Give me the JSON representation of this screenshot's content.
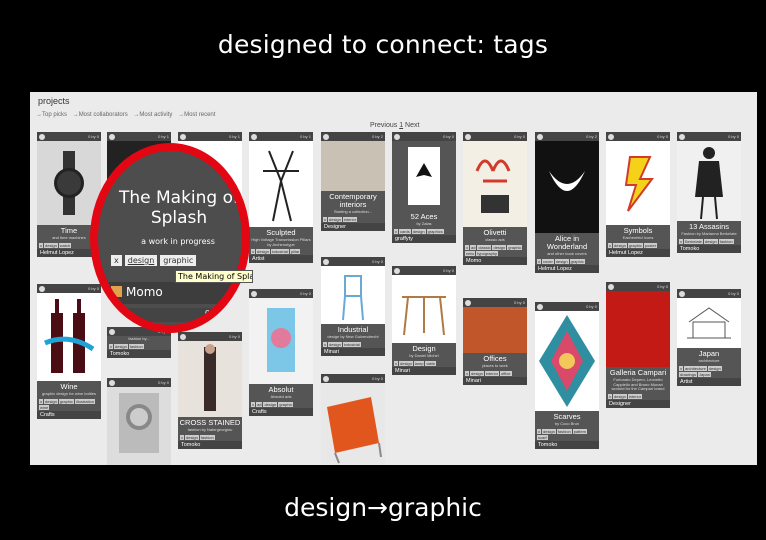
{
  "slide_title": "designed to connect: tags",
  "caption": "design→graphic",
  "app": {
    "heading": "projects",
    "nav": [
      "→Top picks",
      "→Most collaborators",
      "→Most activity",
      "→Most recent"
    ],
    "pager": {
      "prev": "Previous",
      "page": "1",
      "next": "Next"
    }
  },
  "cards": [
    {
      "title": "Time",
      "sub": "and time machines",
      "tags": [
        "x",
        "design",
        "watch"
      ],
      "user": "Helmut Lopez",
      "stat": "0 by 0"
    },
    {
      "title": "",
      "sub": "",
      "tags": [],
      "user": "",
      "stat": "0 by 1"
    },
    {
      "title": "",
      "sub": "",
      "tags": [],
      "user": "",
      "stat": "0 by 1"
    },
    {
      "title": "Sculpted",
      "sub": "High Voltage Transmission Pillars by Archenotype",
      "tags": [
        "x",
        "design",
        "industrial",
        "pillar"
      ],
      "user": "Artist",
      "stat": "0 by 1"
    },
    {
      "title": "Contemporary interiors",
      "sub": "Starting a collection...",
      "tags": [
        "x",
        "design",
        "interior"
      ],
      "user": "Designer",
      "stat": "0 by 2"
    },
    {
      "title": "52 Aces",
      "sub": "by Zalas",
      "tags": [
        "x",
        "cards",
        "design",
        "graphics"
      ],
      "user": "graffyty",
      "stat": "0 by 0"
    },
    {
      "title": "Olivetti",
      "sub": "classic ads",
      "tags": [
        "x",
        "ad",
        "classic",
        "design",
        "graphic",
        "retro",
        "typography"
      ],
      "user": "Momo",
      "stat": "0 by 0"
    },
    {
      "title": "Alice in Wonderland",
      "sub": "and other book covers",
      "tags": [
        "x",
        "cover",
        "design",
        "graphic"
      ],
      "user": "Helmut Lopez",
      "stat": "0 by 2"
    },
    {
      "title": "Symbols",
      "sub": "Eachenfeld Icons",
      "tags": [
        "x",
        "design",
        "graphic",
        "poster"
      ],
      "user": "Helmut Lopez",
      "stat": "0 by 0"
    },
    {
      "title": "13 Assasins",
      "sub": "Fashion by Marianna Berkelate",
      "tags": [
        "x",
        "Berkelate",
        "design",
        "fashion"
      ],
      "user": "Tomoko",
      "stat": "0 by 0"
    },
    {
      "title": "Wine",
      "sub": "graphic design for wine bottles",
      "tags": [
        "x",
        "design",
        "graphic",
        "illustration",
        "wine"
      ],
      "user": "Crafts",
      "stat": "0 by 0"
    },
    {
      "title": "",
      "sub": "fashion by...",
      "tags": [
        "x",
        "design",
        "fashion"
      ],
      "user": "Tomoko",
      "stat": "0 by 0"
    },
    {
      "title": "CROSS STAINED",
      "sub": "fashion by Natergeorgiou",
      "tags": [
        "x",
        "design",
        "fashion"
      ],
      "user": "Tomoko",
      "stat": "0 by 0"
    },
    {
      "title": "Absolut",
      "sub": "Absolut ads",
      "tags": [
        "x",
        "ad",
        "design",
        "graphic"
      ],
      "user": "Crafts",
      "stat": "0 by 0"
    },
    {
      "title": "Industrial",
      "sub": "design by New Gulvendrecht",
      "tags": [
        "x",
        "design",
        "industrial"
      ],
      "user": "Minari",
      "stat": "0 by 0"
    },
    {
      "title": "",
      "sub": "",
      "tags": [],
      "user": "",
      "stat": "0 by 0"
    },
    {
      "title": "Design",
      "sub": "by Daniel Michel",
      "tags": [
        "x",
        "design",
        "lamp",
        "table"
      ],
      "user": "Minari",
      "stat": "0 by 0"
    },
    {
      "title": "Offices",
      "sub": "places to work",
      "tags": [
        "x",
        "design",
        "interior",
        "office"
      ],
      "user": "Minari",
      "stat": "0 by 0"
    },
    {
      "title": "Scarves",
      "sub": "by Coco Brun",
      "tags": [
        "x",
        "design",
        "fashion",
        "pattern",
        "scarf"
      ],
      "user": "Tomoko",
      "stat": "0 by 0"
    },
    {
      "title": "Galleria Campari",
      "sub": "Fortunato Depero, Leonetto Cappiello and Bruno Munari worked for the Campari brand",
      "tags": [
        "x",
        "design",
        "interior"
      ],
      "user": "Designer",
      "stat": "0 by 0"
    },
    {
      "title": "Japan",
      "sub": "architecture",
      "tags": [
        "x",
        "architecture",
        "design",
        "drawings",
        "Japan"
      ],
      "user": "Artist",
      "stat": "0 by 0"
    }
  ],
  "zoom": {
    "title": "The Making of Splash",
    "subtitle": "a work in progress",
    "tags": [
      "x",
      "design",
      "graphic"
    ],
    "user": "Momo",
    "stat": "0 by 0"
  },
  "tooltip": "The Making of Splash"
}
